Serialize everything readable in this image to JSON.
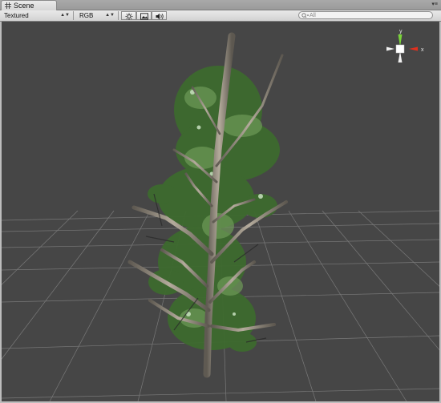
{
  "tab": {
    "title": "Scene",
    "icon": "scene-grid-icon"
  },
  "toolbar": {
    "draw_mode": "Textured",
    "render_mode": "RGB",
    "buttons": [
      "lighting-icon",
      "image-effects-icon",
      "audio-icon"
    ],
    "search_placeholder": "All"
  },
  "gizmo": {
    "y_label": "y",
    "x_label": "x",
    "y_color": "#7ad33a",
    "x_color": "#e0301e"
  },
  "colors": {
    "viewport_bg": "#464646",
    "grid": "#8a8a8a",
    "leaf": "#4f7a3a",
    "bark": "#8b8478"
  }
}
